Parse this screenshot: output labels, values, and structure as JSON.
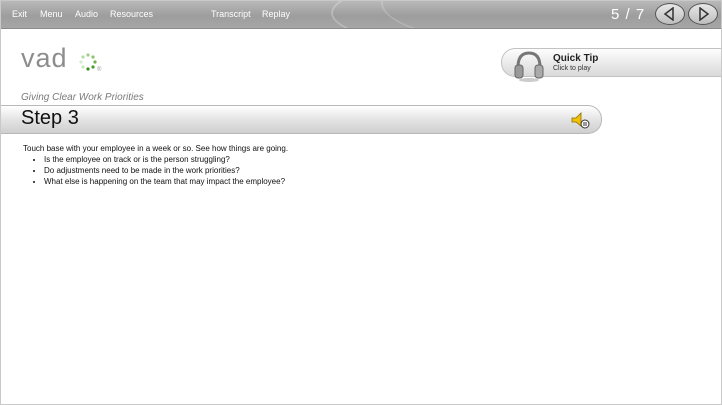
{
  "nav": {
    "exit": "Exit",
    "menu": "Menu",
    "audio": "Audio",
    "resources": "Resources",
    "transcript": "Transcript",
    "replay": "Replay"
  },
  "page_counter": "5 / 7",
  "icons": {
    "prev": "chevron-left-icon",
    "next": "chevron-right-icon",
    "quick_tip": "headphones-icon",
    "audio": "speaker-icon"
  },
  "logo": {
    "text": "vad",
    "registered": "®"
  },
  "quick_tip": {
    "title": "Quick Tip",
    "subtitle": "Click to play"
  },
  "course_title": "Giving Clear Work Priorities",
  "step": {
    "title": "Step 3"
  },
  "content": {
    "intro": "Touch base with your employee in a week or so. See how things are going.",
    "bullets": [
      "Is the employee on track or is the person struggling?",
      "Do adjustments need to be made in the work priorities?",
      "What else is happening on the team that may impact the employee?"
    ]
  },
  "colors": {
    "topbar": "#a8a8a8",
    "logo_green": "#4a9a2a"
  }
}
